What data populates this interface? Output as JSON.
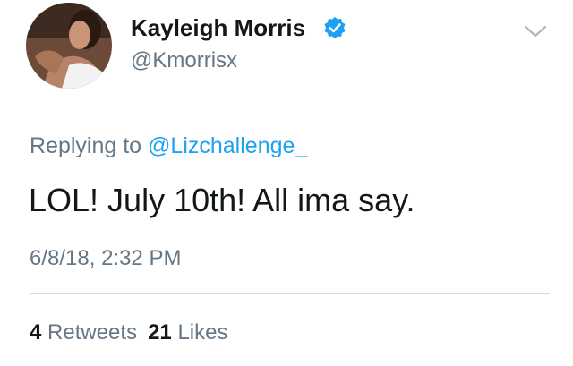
{
  "author": {
    "display_name": "Kayleigh Morris",
    "handle": "@Kmorrisx",
    "verified": true,
    "avatar_icon": "profile-photo-avatar"
  },
  "reply": {
    "prefix": "Replying to ",
    "mention": "@Lizchallenge_"
  },
  "tweet": {
    "text": "LOL! July 10th! All ima say.",
    "timestamp": "6/8/18, 2:32 PM"
  },
  "stats": {
    "retweets_count": "4",
    "retweets_label": "Retweets",
    "likes_count": "21",
    "likes_label": "Likes"
  },
  "icons": {
    "verified": "verified-badge-icon",
    "menu": "chevron-down-icon"
  },
  "colors": {
    "accent": "#1da1f2",
    "secondary_text": "#657786",
    "primary_text": "#14171a"
  }
}
